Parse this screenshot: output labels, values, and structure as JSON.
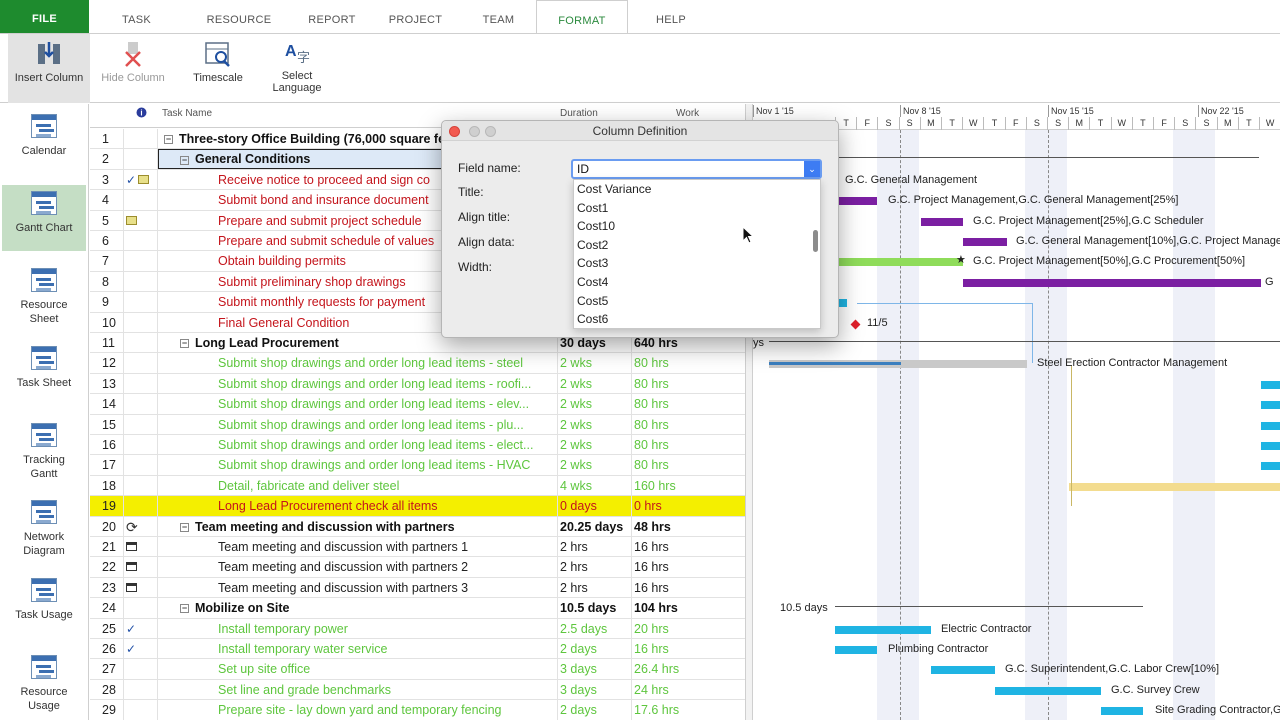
{
  "tabs": [
    "FILE",
    "TASK",
    "RESOURCE",
    "REPORT",
    "PROJECT",
    "TEAM",
    "FORMAT",
    "HELP"
  ],
  "active_tab": "FORMAT",
  "ribbon": {
    "insert_column": "Insert Column",
    "hide_column": "Hide Column",
    "timescale": "Timescale",
    "select_language_1": "Select",
    "select_language_2": "Language"
  },
  "views": [
    {
      "l1": "Calendar",
      "l2": ""
    },
    {
      "l1": "Gantt Chart",
      "l2": ""
    },
    {
      "l1": "Resource",
      "l2": "Sheet"
    },
    {
      "l1": "Task Sheet",
      "l2": ""
    },
    {
      "l1": "Tracking",
      "l2": "Gantt"
    },
    {
      "l1": "Network",
      "l2": "Diagram"
    },
    {
      "l1": "Task Usage",
      "l2": ""
    },
    {
      "l1": "Resource",
      "l2": "Usage"
    }
  ],
  "grid": {
    "col_task_name": "Task Name",
    "col_duration": "Duration",
    "col_work": "Work",
    "rows": [
      {
        "id": "1",
        "name": "Three-story Office Building (76,000 square feet)",
        "dur": "",
        "work": "",
        "style": "bold",
        "lvl": 0,
        "collapse": true
      },
      {
        "id": "2",
        "name": "General Conditions",
        "dur": "",
        "work": "",
        "style": "bold",
        "lvl": 1,
        "collapse": true
      },
      {
        "id": "3",
        "name": "Receive notice to proceed and sign co",
        "dur": "",
        "work": "",
        "style": "red",
        "lvl": 2
      },
      {
        "id": "4",
        "name": "Submit bond and insurance document",
        "dur": "",
        "work": "",
        "style": "red",
        "lvl": 2
      },
      {
        "id": "5",
        "name": "Prepare and submit project schedule",
        "dur": "",
        "work": "",
        "style": "red",
        "lvl": 2
      },
      {
        "id": "6",
        "name": "Prepare and submit schedule of values",
        "dur": "",
        "work": "",
        "style": "red",
        "lvl": 2
      },
      {
        "id": "7",
        "name": "Obtain building permits",
        "dur": "",
        "work": "",
        "style": "red",
        "lvl": 2
      },
      {
        "id": "8",
        "name": "Submit preliminary shop drawings",
        "dur": "",
        "work": "",
        "style": "red",
        "lvl": 2
      },
      {
        "id": "9",
        "name": "Submit monthly requests for payment",
        "dur": "",
        "work": "",
        "style": "red",
        "lvl": 2
      },
      {
        "id": "10",
        "name": "Final General Condition",
        "dur": "",
        "work": "",
        "style": "red",
        "lvl": 2
      },
      {
        "id": "11",
        "name": "Long Lead Procurement",
        "dur": "30 days",
        "work": "640 hrs",
        "style": "bold",
        "lvl": 1,
        "collapse": true
      },
      {
        "id": "12",
        "name": "Submit shop drawings and order long lead items - steel",
        "dur": "2 wks",
        "work": "80 hrs",
        "style": "green",
        "lvl": 2
      },
      {
        "id": "13",
        "name": "Submit shop drawings and order long lead items - roofi...",
        "dur": "2 wks",
        "work": "80 hrs",
        "style": "green",
        "lvl": 2
      },
      {
        "id": "14",
        "name": "Submit shop drawings and order long lead items - elev...",
        "dur": "2 wks",
        "work": "80 hrs",
        "style": "green",
        "lvl": 2
      },
      {
        "id": "15",
        "name": "Submit shop drawings and order long lead items - plu...",
        "dur": "2 wks",
        "work": "80 hrs",
        "style": "green",
        "lvl": 2
      },
      {
        "id": "16",
        "name": "Submit shop drawings and order long lead items - elect...",
        "dur": "2 wks",
        "work": "80 hrs",
        "style": "green",
        "lvl": 2
      },
      {
        "id": "17",
        "name": "Submit shop drawings and order long lead items - HVAC",
        "dur": "2 wks",
        "work": "80 hrs",
        "style": "green",
        "lvl": 2
      },
      {
        "id": "18",
        "name": "Detail, fabricate and deliver steel",
        "dur": "4 wks",
        "work": "160 hrs",
        "style": "green",
        "lvl": 2
      },
      {
        "id": "19",
        "name": "Long Lead Procurement check all items",
        "dur": "0 days",
        "work": "0 hrs",
        "style": "red",
        "lvl": 2,
        "highlight": true
      },
      {
        "id": "20",
        "name": "Team meeting and discussion with partners",
        "dur": "20.25 days",
        "work": "48 hrs",
        "style": "bold",
        "lvl": 1,
        "collapse": true
      },
      {
        "id": "21",
        "name": "Team meeting and discussion with partners 1",
        "dur": "2 hrs",
        "work": "16 hrs",
        "style": "plain",
        "lvl": 2
      },
      {
        "id": "22",
        "name": "Team meeting and discussion with partners 2",
        "dur": "2 hrs",
        "work": "16 hrs",
        "style": "plain",
        "lvl": 2
      },
      {
        "id": "23",
        "name": "Team meeting and discussion with partners 3",
        "dur": "2 hrs",
        "work": "16 hrs",
        "style": "plain",
        "lvl": 2
      },
      {
        "id": "24",
        "name": "Mobilize on Site",
        "dur": "10.5 days",
        "work": "104 hrs",
        "style": "bold",
        "lvl": 1,
        "collapse": true
      },
      {
        "id": "25",
        "name": "Install temporary power",
        "dur": "2.5 days",
        "work": "20 hrs",
        "style": "green",
        "lvl": 2
      },
      {
        "id": "26",
        "name": "Install temporary water service",
        "dur": "2 days",
        "work": "16 hrs",
        "style": "green",
        "lvl": 2
      },
      {
        "id": "27",
        "name": "Set up site office",
        "dur": "3 days",
        "work": "26.4 hrs",
        "style": "green",
        "lvl": 2
      },
      {
        "id": "28",
        "name": "Set line and grade benchmarks",
        "dur": "3 days",
        "work": "24 hrs",
        "style": "green",
        "lvl": 2
      },
      {
        "id": "29",
        "name": "Prepare site - lay down yard and temporary fencing",
        "dur": "2 days",
        "work": "17.6 hrs",
        "style": "green",
        "lvl": 2
      }
    ]
  },
  "timescale": {
    "weeks": [
      "Nov 1 '15",
      "Nov 8 '15",
      "Nov 15 '15",
      "Nov 22 '15"
    ],
    "days": [
      "T",
      "F",
      "S",
      "S",
      "M",
      "T",
      "W",
      "T",
      "F",
      "S",
      "S",
      "M",
      "T",
      "W",
      "T",
      "F",
      "S",
      "S",
      "M",
      "T",
      "W",
      "T",
      "F",
      "S",
      "S",
      "M",
      "T"
    ]
  },
  "gantt_labels": {
    "l3": "G.C. General Management",
    "l4": "G.C. Project Management,G.C. General Management[25%]",
    "l5": "G.C. Project Management[25%],G.C Scheduler",
    "l6": "G.C. General Management[10%],G.C. Project Manage",
    "l7": "G.C. Project Management[50%],G.C Procurement[50%]",
    "l8": "G",
    "l10": "11/5",
    "l11": "ys",
    "l12": "Steel Erection Contractor Management",
    "l24": "10.5 days",
    "l25": "Electric Contractor",
    "l26": "Plumbing Contractor",
    "l27": "G.C. Superintendent,G.C. Labor Crew[10%]",
    "l28": "G.C. Survey Crew",
    "l29": "Site Grading Contractor,G"
  },
  "dialog": {
    "title": "Column Definition",
    "field_name_label": "Field name:",
    "title_label": "Title:",
    "align_title_label": "Align title:",
    "align_data_label": "Align data:",
    "width_label": "Width:",
    "field_value": "ID",
    "options": [
      "Cost Variance",
      "Cost1",
      "Cost10",
      "Cost2",
      "Cost3",
      "Cost4",
      "Cost5",
      "Cost6"
    ]
  },
  "colors": {
    "file_tab": "#1e8b2e",
    "critical_text": "#c4151c",
    "done_text": "#5ec63e",
    "highlight": "#f4ef00",
    "bar_purple": "#7b1fa2",
    "bar_cyan": "#1fb4e3",
    "bar_green": "#8fdc5a"
  }
}
